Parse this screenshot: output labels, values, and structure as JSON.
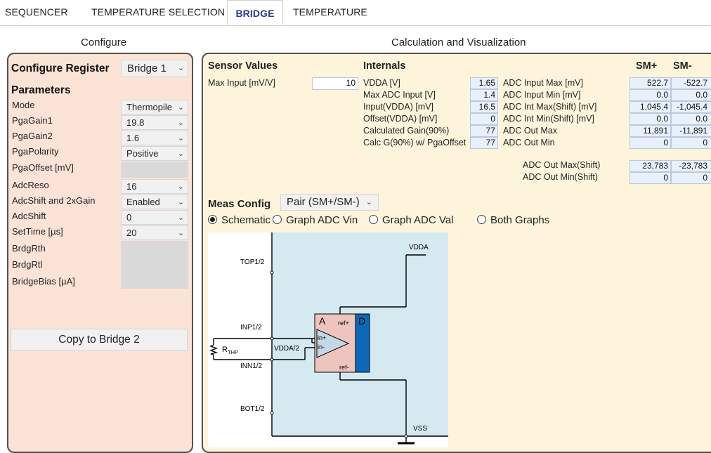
{
  "tabs": [
    {
      "label": "SEQUENCER",
      "active": false
    },
    {
      "label": "TEMPERATURE SELECTION",
      "active": false
    },
    {
      "label": "BRIDGE",
      "active": true
    },
    {
      "label": "TEMPERATURE",
      "active": false
    }
  ],
  "configure": {
    "title": "Configure",
    "register_label": "Configure Register",
    "register_value": "Bridge 1",
    "parameters_label": "Parameters",
    "params": [
      {
        "label": "Mode",
        "value": "Thermopile",
        "type": "select"
      },
      {
        "label": "PgaGain1",
        "value": "19.8",
        "type": "select"
      },
      {
        "label": "PgaGain2",
        "value": "1.6",
        "type": "select"
      },
      {
        "label": "PgaPolarity",
        "value": "Positive",
        "type": "select"
      },
      {
        "label": "PgaOffset [mV]",
        "value": "",
        "type": "disabled"
      },
      {
        "label": "AdcReso",
        "value": "16",
        "type": "select"
      },
      {
        "label": "AdcShift and 2xGain",
        "value": "Enabled",
        "type": "select"
      },
      {
        "label": "AdcShift",
        "value": "0",
        "type": "select"
      },
      {
        "label": "SetTime [µs]",
        "value": "20",
        "type": "select"
      },
      {
        "label": "BrdgRth",
        "value": "",
        "type": "disabled"
      },
      {
        "label": "BrdgRtl",
        "value": "",
        "type": "disabled"
      },
      {
        "label": "BridgeBias [µA]",
        "value": "",
        "type": "disabled"
      }
    ],
    "copy_button": "Copy to Bridge 2"
  },
  "calc": {
    "title": "Calculation and Visualization",
    "sensor_values_label": "Sensor Values",
    "max_input_label": "Max Input [mV/V]",
    "max_input_value": "10",
    "internals_label": "Internals",
    "internals": [
      {
        "label": "VDDA [V]",
        "value": "1.65"
      },
      {
        "label": "Max ADC Input [V]",
        "value": "1.4"
      },
      {
        "label": "Input(VDDA) [mV]",
        "value": "16.5"
      },
      {
        "label": "Offset(VDDA) [mV]",
        "value": "0"
      },
      {
        "label": "Calculated Gain(90%)",
        "value": "77"
      },
      {
        "label": "Calc G(90%) w/ PgaOffset",
        "value": "77"
      }
    ],
    "sm_plus_header": "SM+",
    "sm_minus_header": "SM-",
    "adc_rows": [
      {
        "label": "ADC Input Max [mV]",
        "plus": "522.7",
        "minus": "-522.7"
      },
      {
        "label": "ADC Input Min [mV]",
        "plus": "0.0",
        "minus": "0.0"
      },
      {
        "label": "ADC Int Max(Shift) [mV]",
        "plus": "1,045.4",
        "minus": "-1,045.4"
      },
      {
        "label": "ADC Int Min(Shift)  [mV]",
        "plus": "0.0",
        "minus": "0.0"
      },
      {
        "label": "ADC Out Max",
        "plus": "11,891",
        "minus": "-11,891"
      },
      {
        "label": "ADC Out Min",
        "plus": "0",
        "minus": "0"
      },
      {
        "label": "ADC Out Max(Shift)",
        "plus": "23,783",
        "minus": "-23,783"
      },
      {
        "label": "ADC Out Min(Shift)",
        "plus": "0",
        "minus": "0"
      }
    ],
    "meas_config_label": "Meas Config",
    "meas_config_value": "Pair (SM+/SM-)",
    "view_options": [
      {
        "label": "Schematic",
        "selected": true
      },
      {
        "label": "Graph ADC Vin",
        "selected": false
      },
      {
        "label": "Graph ADC Val",
        "selected": false
      },
      {
        "label": "Both Graphs",
        "selected": false
      }
    ]
  },
  "schematic": {
    "labels": {
      "vdda": "VDDA",
      "top": "TOP1/2",
      "inp": "INP1/2",
      "inn": "INN1/2",
      "bot": "BOT1/2",
      "vss": "VSS",
      "vdda_half": "VDDA/2",
      "block_a": "A",
      "block_d": "D",
      "ref_plus": "ref+",
      "ref_minus": "ref-",
      "in_plus": "in+",
      "in_minus": "in-",
      "resistor": "R",
      "resistor_sub": "THP"
    },
    "colors": {
      "background": "#d5e9f1",
      "adc_block": "#eec4bf",
      "digital_block": "#0b69b8"
    }
  },
  "colors": {
    "configure_panel": "#fbe3d6",
    "calc_panel": "#fef4dc",
    "active_tab_text": "#2a3c8f",
    "value_box": "#e8f1fb"
  }
}
